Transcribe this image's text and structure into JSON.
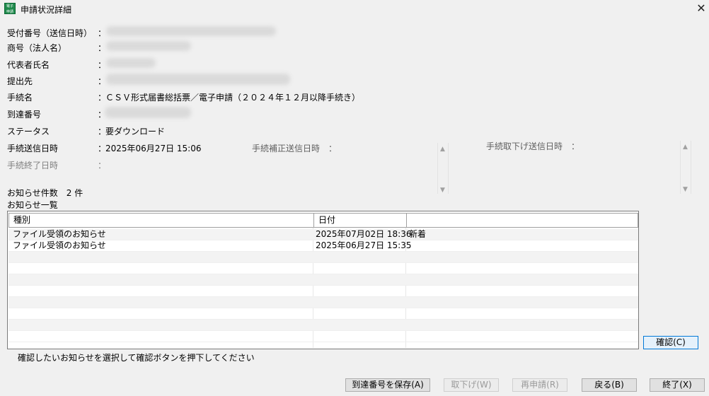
{
  "window": {
    "title": "申請状況詳細",
    "close_glyph": "✕",
    "icon_text": "電子申請"
  },
  "fields": {
    "receipt_no_label": "受付番号（送信日時）",
    "company_label": "商号（法人名）",
    "rep_label": "代表者氏名",
    "dest_label": "提出先",
    "procedure_label": "手続名",
    "procedure_value": "ＣＳＶ形式届書総括票／電子申請（２０２４年１２月以降手続き）",
    "arrival_label": "到達番号",
    "status_label": "ステータス",
    "status_value": "要ダウンロード",
    "sent_label": "手続送信日時",
    "sent_value": "2025年06月27日 15:06",
    "end_label": "手続終了日時",
    "colon": "："
  },
  "side": {
    "correction_label": "手続補正送信日時　：",
    "withdraw_label": "手続取下げ送信日時　：",
    "arrow_up": "▲",
    "arrow_down": "▼"
  },
  "notices": {
    "count_text": "お知らせ件数　2 件",
    "list_title": "お知らせ一覧",
    "columns": [
      "種別",
      "日付",
      ""
    ],
    "rows": [
      {
        "type": "ファイル受領のお知らせ",
        "date": "2025年07月02日 18:36",
        "flag": "新着"
      },
      {
        "type": "ファイル受領のお知らせ",
        "date": "2025年06月27日 15:35",
        "flag": ""
      }
    ]
  },
  "hint": "確認したいお知らせを選択して確認ボタンを押下してください",
  "buttons": {
    "confirm": "確認(C)",
    "save_arrival": "到達番号を保存(A)",
    "withdraw": "取下げ(W)",
    "reapply": "再申請(R)",
    "back": "戻る(B)",
    "exit": "終了(X)"
  }
}
